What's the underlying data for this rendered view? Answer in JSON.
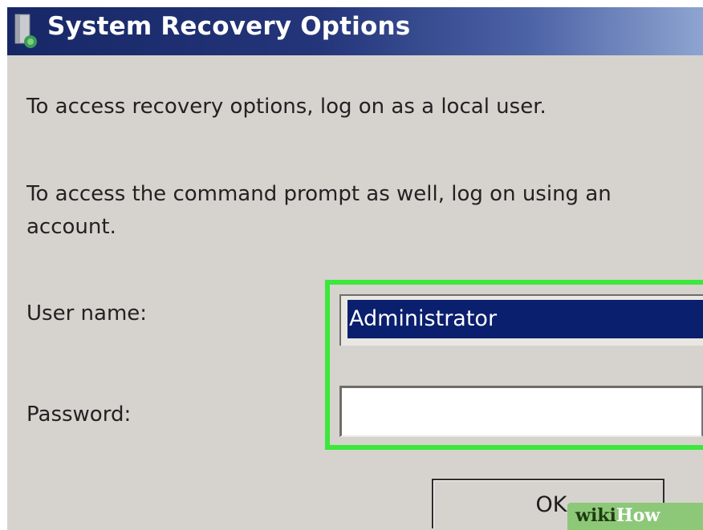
{
  "window": {
    "title": "System Recovery Options"
  },
  "instructions": {
    "line1": "To access recovery options, log on as a local user.",
    "line2": "To access the command prompt as well, log on using an",
    "line3": "account."
  },
  "form": {
    "user_name_label": "User name:",
    "user_name_value": "Administrator",
    "password_label": "Password:",
    "password_value": ""
  },
  "buttons": {
    "ok_label": "OK"
  },
  "watermark": {
    "part1": "wiki",
    "part2": "How"
  },
  "colors": {
    "highlight": "#3be83b",
    "titlebar": "#1e2f70",
    "selection": "#0a1f6e",
    "dialog_background": "#d6d3ce"
  },
  "icons": {
    "title": "recovery-disk-icon"
  }
}
